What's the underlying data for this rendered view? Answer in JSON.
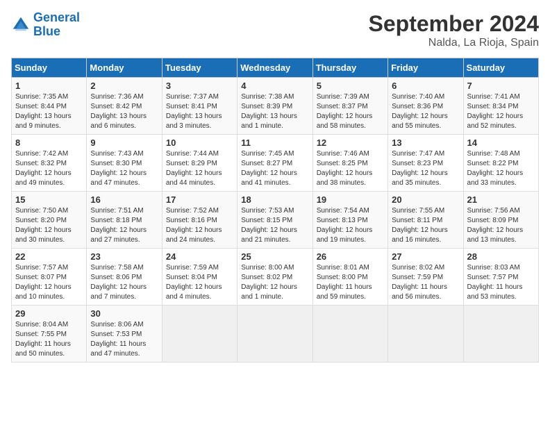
{
  "header": {
    "logo_line1": "General",
    "logo_line2": "Blue",
    "month_title": "September 2024",
    "location": "Nalda, La Rioja, Spain"
  },
  "weekdays": [
    "Sunday",
    "Monday",
    "Tuesday",
    "Wednesday",
    "Thursday",
    "Friday",
    "Saturday"
  ],
  "weeks": [
    [
      {
        "day": "1",
        "sunrise": "7:35 AM",
        "sunset": "8:44 PM",
        "daylight": "13 hours and 9 minutes."
      },
      {
        "day": "2",
        "sunrise": "7:36 AM",
        "sunset": "8:42 PM",
        "daylight": "13 hours and 6 minutes."
      },
      {
        "day": "3",
        "sunrise": "7:37 AM",
        "sunset": "8:41 PM",
        "daylight": "13 hours and 3 minutes."
      },
      {
        "day": "4",
        "sunrise": "7:38 AM",
        "sunset": "8:39 PM",
        "daylight": "13 hours and 1 minute."
      },
      {
        "day": "5",
        "sunrise": "7:39 AM",
        "sunset": "8:37 PM",
        "daylight": "12 hours and 58 minutes."
      },
      {
        "day": "6",
        "sunrise": "7:40 AM",
        "sunset": "8:36 PM",
        "daylight": "12 hours and 55 minutes."
      },
      {
        "day": "7",
        "sunrise": "7:41 AM",
        "sunset": "8:34 PM",
        "daylight": "12 hours and 52 minutes."
      }
    ],
    [
      {
        "day": "8",
        "sunrise": "7:42 AM",
        "sunset": "8:32 PM",
        "daylight": "12 hours and 49 minutes."
      },
      {
        "day": "9",
        "sunrise": "7:43 AM",
        "sunset": "8:30 PM",
        "daylight": "12 hours and 47 minutes."
      },
      {
        "day": "10",
        "sunrise": "7:44 AM",
        "sunset": "8:29 PM",
        "daylight": "12 hours and 44 minutes."
      },
      {
        "day": "11",
        "sunrise": "7:45 AM",
        "sunset": "8:27 PM",
        "daylight": "12 hours and 41 minutes."
      },
      {
        "day": "12",
        "sunrise": "7:46 AM",
        "sunset": "8:25 PM",
        "daylight": "12 hours and 38 minutes."
      },
      {
        "day": "13",
        "sunrise": "7:47 AM",
        "sunset": "8:23 PM",
        "daylight": "12 hours and 35 minutes."
      },
      {
        "day": "14",
        "sunrise": "7:48 AM",
        "sunset": "8:22 PM",
        "daylight": "12 hours and 33 minutes."
      }
    ],
    [
      {
        "day": "15",
        "sunrise": "7:50 AM",
        "sunset": "8:20 PM",
        "daylight": "12 hours and 30 minutes."
      },
      {
        "day": "16",
        "sunrise": "7:51 AM",
        "sunset": "8:18 PM",
        "daylight": "12 hours and 27 minutes."
      },
      {
        "day": "17",
        "sunrise": "7:52 AM",
        "sunset": "8:16 PM",
        "daylight": "12 hours and 24 minutes."
      },
      {
        "day": "18",
        "sunrise": "7:53 AM",
        "sunset": "8:15 PM",
        "daylight": "12 hours and 21 minutes."
      },
      {
        "day": "19",
        "sunrise": "7:54 AM",
        "sunset": "8:13 PM",
        "daylight": "12 hours and 19 minutes."
      },
      {
        "day": "20",
        "sunrise": "7:55 AM",
        "sunset": "8:11 PM",
        "daylight": "12 hours and 16 minutes."
      },
      {
        "day": "21",
        "sunrise": "7:56 AM",
        "sunset": "8:09 PM",
        "daylight": "12 hours and 13 minutes."
      }
    ],
    [
      {
        "day": "22",
        "sunrise": "7:57 AM",
        "sunset": "8:07 PM",
        "daylight": "12 hours and 10 minutes."
      },
      {
        "day": "23",
        "sunrise": "7:58 AM",
        "sunset": "8:06 PM",
        "daylight": "12 hours and 7 minutes."
      },
      {
        "day": "24",
        "sunrise": "7:59 AM",
        "sunset": "8:04 PM",
        "daylight": "12 hours and 4 minutes."
      },
      {
        "day": "25",
        "sunrise": "8:00 AM",
        "sunset": "8:02 PM",
        "daylight": "12 hours and 1 minute."
      },
      {
        "day": "26",
        "sunrise": "8:01 AM",
        "sunset": "8:00 PM",
        "daylight": "11 hours and 59 minutes."
      },
      {
        "day": "27",
        "sunrise": "8:02 AM",
        "sunset": "7:59 PM",
        "daylight": "11 hours and 56 minutes."
      },
      {
        "day": "28",
        "sunrise": "8:03 AM",
        "sunset": "7:57 PM",
        "daylight": "11 hours and 53 minutes."
      }
    ],
    [
      {
        "day": "29",
        "sunrise": "8:04 AM",
        "sunset": "7:55 PM",
        "daylight": "11 hours and 50 minutes."
      },
      {
        "day": "30",
        "sunrise": "8:06 AM",
        "sunset": "7:53 PM",
        "daylight": "11 hours and 47 minutes."
      },
      null,
      null,
      null,
      null,
      null
    ]
  ]
}
